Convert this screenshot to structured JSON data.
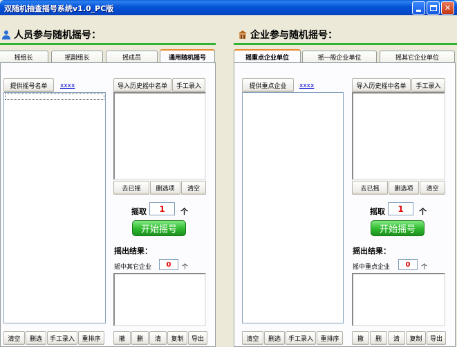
{
  "window": {
    "title": "双随机抽查摇号系统v1.0_PC版"
  },
  "person": {
    "heading": "人员参与随机摇号：",
    "tabs": [
      "摇组长",
      "摇副组长",
      "摇成员",
      "通用随机摇号"
    ],
    "provide_button": "提供摇号名单",
    "link": "xxxx",
    "import_button": "导入历史摇中名单",
    "manual_button": "手工录入",
    "remove_button": "去已摇",
    "delete_selected_button": "删选项",
    "clear_button": "清空",
    "draw_label": "摇取",
    "draw_value": "1",
    "draw_unit": "个",
    "start_button": "开始摇号",
    "result_label": "摇出结果：",
    "result_count_label": "摇中其它企业",
    "result_count_value": "0",
    "result_count_unit": "个",
    "bottom_left": [
      "清空",
      "删选",
      "手工录入",
      "重排序"
    ],
    "bottom_right": [
      "撤",
      "删",
      "清",
      "复制",
      "导出"
    ]
  },
  "enterprise": {
    "heading": "企业参与随机摇号：",
    "tabs": [
      "摇重点企业单位",
      "摇一般企业单位",
      "摇其它企业单位"
    ],
    "provide_button": "提供重点企业",
    "link": "xxxx",
    "import_button": "导入历史摇中名单",
    "manual_button": "手工录入",
    "remove_button": "去已摇",
    "delete_selected_button": "删选项",
    "clear_button": "清空",
    "draw_label": "摇取",
    "draw_value": "1",
    "draw_unit": "个",
    "start_button": "开始摇号",
    "result_label": "摇出结果：",
    "result_count_label": "摇中重点企业",
    "result_count_value": "0",
    "result_count_unit": "个",
    "bottom_left": [
      "清空",
      "删选",
      "手工录入",
      "重排序"
    ],
    "bottom_right": [
      "撤",
      "删",
      "清",
      "复制",
      "导出"
    ]
  }
}
